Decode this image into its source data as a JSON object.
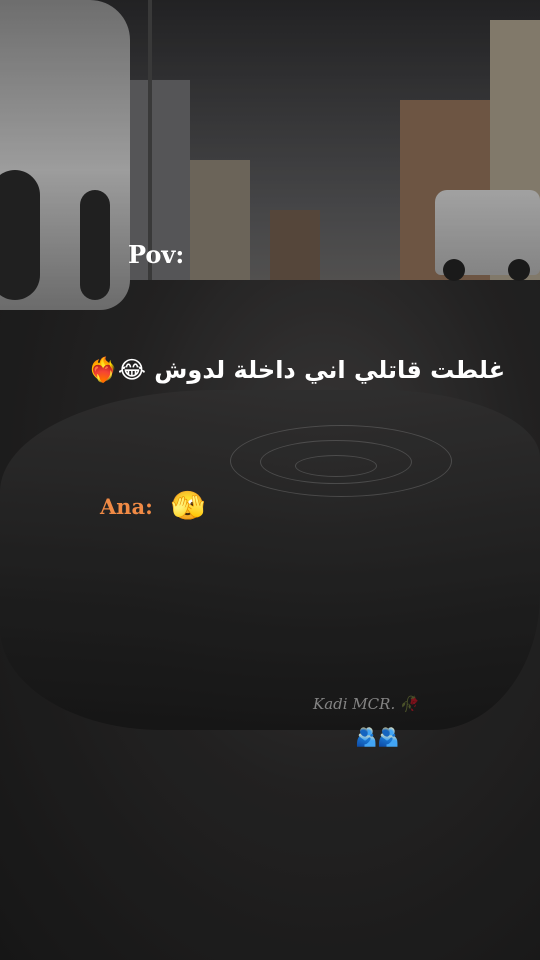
{
  "overlay": {
    "pov_label": "Pov:",
    "arabic_line": "غلطت قاتلي اني داخلة لدوش 😂❤️‍🔥",
    "ana_label": "Ana:",
    "ana_emoji": "🫣",
    "signature": "Kadi MCR.",
    "signature_emoji": "🥀",
    "hug_emojis": "🫂🫂"
  },
  "colors": {
    "ana_label": "#f08a45",
    "text": "#ffffff"
  }
}
